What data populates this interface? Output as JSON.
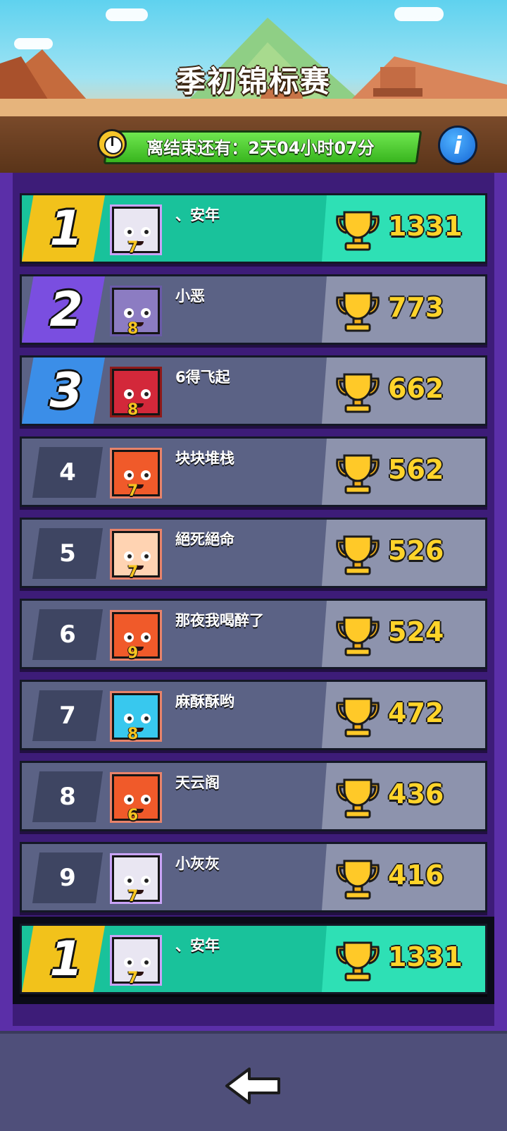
{
  "header": {
    "title": "季初锦标赛",
    "timer_label": "离结束还有：2天04小时07分",
    "clock_icon": "clock-icon",
    "info_label": "i"
  },
  "colors": {
    "accent_green": "#19c29b",
    "row_gray": "#5b6285",
    "gold": "#ffd42a",
    "rank1": "#f2c21b",
    "rank2": "#7a4ee0",
    "rank3": "#3b8ee8"
  },
  "leaderboard": [
    {
      "rank": "1",
      "name": "、安年",
      "level": "7",
      "score": "1331",
      "avatar": "robot-avatar"
    },
    {
      "rank": "2",
      "name": "小恶",
      "level": "8",
      "score": "773",
      "avatar": "bandaged-avatar"
    },
    {
      "rank": "3",
      "name": "6得飞起",
      "level": "8",
      "score": "662",
      "avatar": "angry-red-avatar"
    },
    {
      "rank": "4",
      "name": "块块堆栈",
      "level": "7",
      "score": "562",
      "avatar": "orange-squid-avatar"
    },
    {
      "rank": "5",
      "name": "絕死絕命",
      "level": "7",
      "score": "526",
      "avatar": "winking-girl-avatar"
    },
    {
      "rank": "6",
      "name": "那夜我喝醉了",
      "level": "9",
      "score": "524",
      "avatar": "orange-squid-avatar"
    },
    {
      "rank": "7",
      "name": "麻酥酥哟",
      "level": "8",
      "score": "472",
      "avatar": "cyan-crying-avatar"
    },
    {
      "rank": "8",
      "name": "天云阁",
      "level": "6",
      "score": "436",
      "avatar": "orange-squid-avatar"
    },
    {
      "rank": "9",
      "name": "小灰灰",
      "level": "7",
      "score": "416",
      "avatar": "robot-avatar"
    }
  ],
  "my_entry": {
    "rank": "1",
    "name": "、安年",
    "level": "7",
    "score": "1331",
    "avatar": "robot-avatar"
  },
  "footer": {
    "back_icon": "back-arrow-icon"
  }
}
